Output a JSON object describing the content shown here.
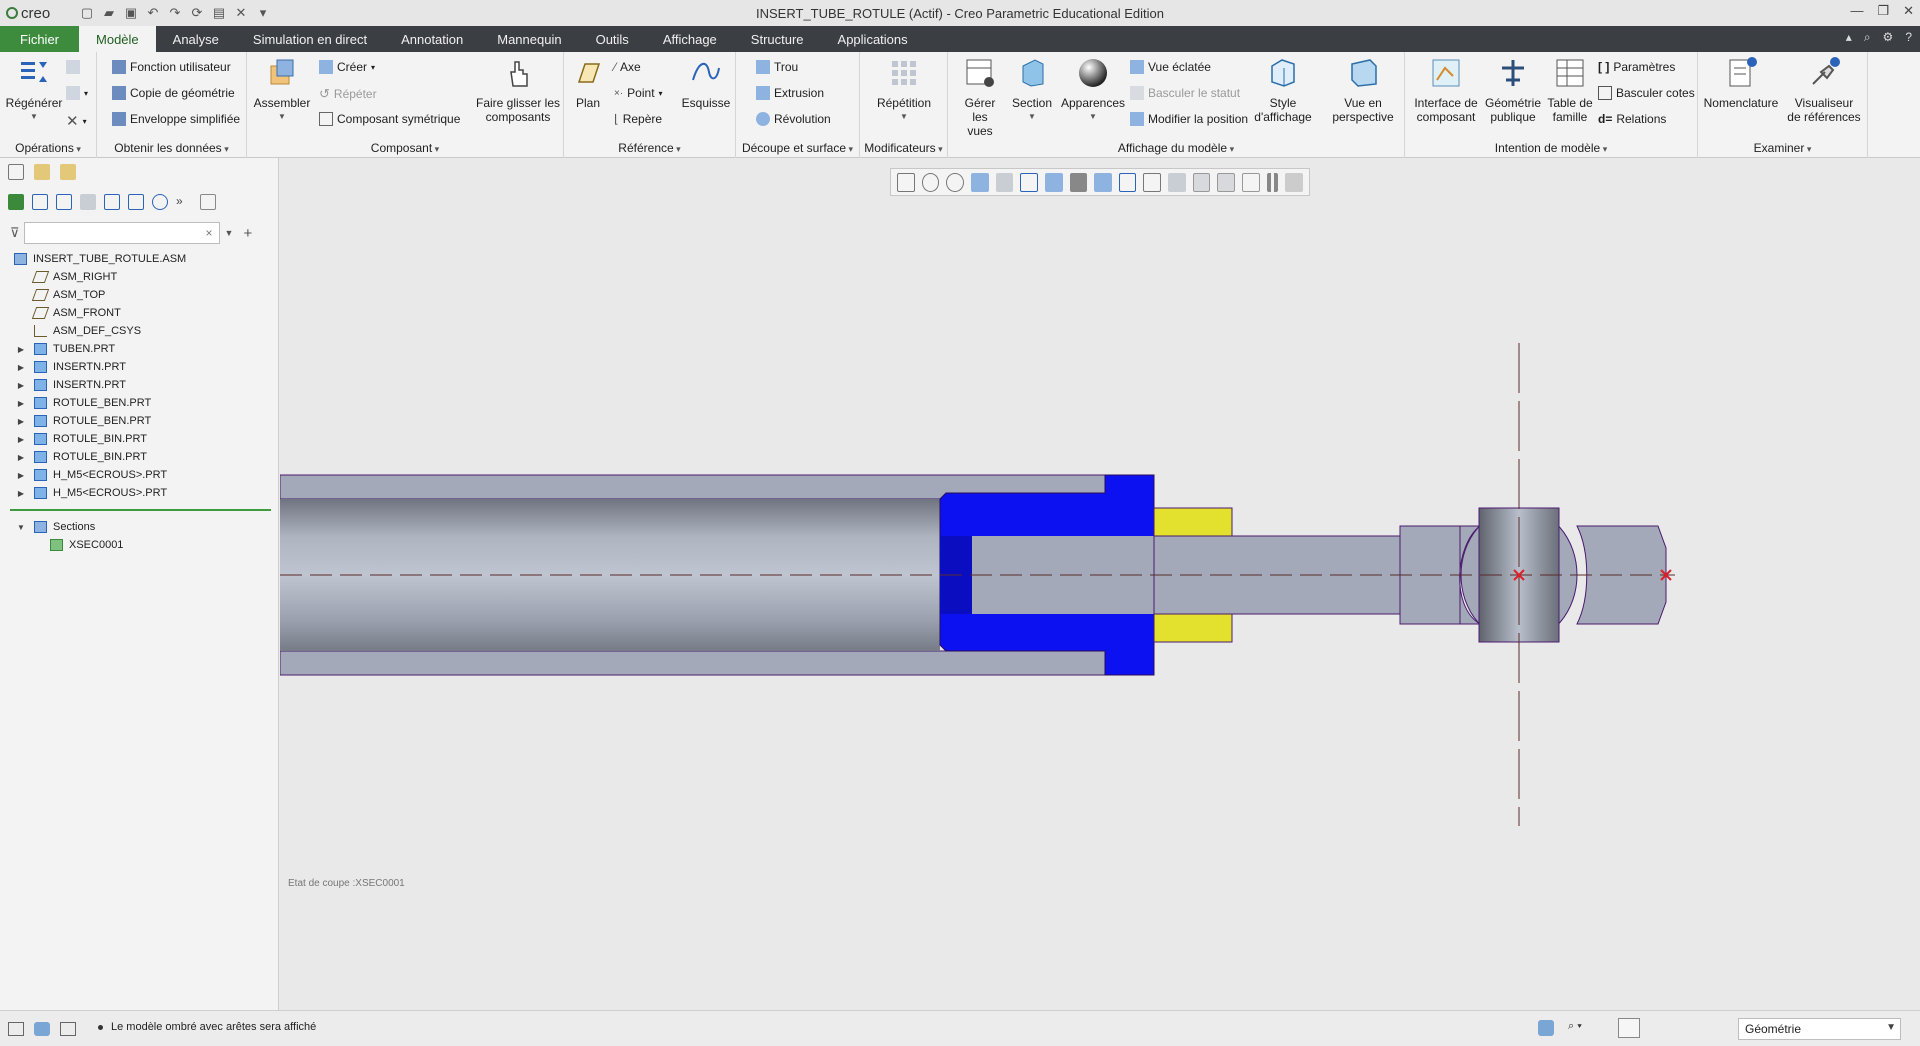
{
  "window": {
    "app_logo": "creo",
    "title": "INSERT_TUBE_ROTULE (Actif) - Creo Parametric Educational Edition",
    "quick_access_icons": [
      "new-icon",
      "open-icon",
      "save-icon",
      "undo-icon",
      "redo-icon",
      "regenerate-icon",
      "windows-icon",
      "close-window-icon",
      "customize-icon"
    ],
    "controls": [
      "minimize",
      "restore",
      "close"
    ]
  },
  "tabs": [
    {
      "label": "Fichier",
      "kind": "file"
    },
    {
      "label": "Modèle",
      "kind": "active"
    },
    {
      "label": "Analyse"
    },
    {
      "label": "Simulation en direct"
    },
    {
      "label": "Annotation"
    },
    {
      "label": "Mannequin"
    },
    {
      "label": "Outils"
    },
    {
      "label": "Affichage"
    },
    {
      "label": "Structure"
    },
    {
      "label": "Applications"
    }
  ],
  "ribbon": {
    "groups": {
      "operations": "Opérations",
      "obtenir": "Obtenir les données",
      "composant": "Composant",
      "reference": "Référence",
      "decoupe": "Découpe et surface",
      "modificateurs": "Modificateurs",
      "affichage": "Affichage du modèle",
      "intention": "Intention de modèle",
      "examiner": "Examiner"
    },
    "buttons": {
      "regenerer": "Régénérer",
      "fonction_utilisateur": "Fonction utilisateur",
      "copie_geometrie": "Copie de géométrie",
      "enveloppe": "Enveloppe simplifiée",
      "assembler": "Assembler",
      "creer": "Créer",
      "repeter": "Répéter",
      "composant_symetrique": "Composant symétrique",
      "faire_glisser_1": "Faire glisser les",
      "faire_glisser_2": "composants",
      "plan": "Plan",
      "axe": "Axe",
      "point": "Point",
      "repere": "Repère",
      "esquisse": "Esquisse",
      "trou": "Trou",
      "extrusion": "Extrusion",
      "revolution": "Révolution",
      "repetition": "Répétition",
      "gerer_vues_1": "Gérer les",
      "gerer_vues_2": "vues",
      "section": "Section",
      "apparences": "Apparences",
      "vue_eclatee": "Vue éclatée",
      "basculer_statut": "Basculer le statut",
      "modifier_position": "Modifier la position",
      "style_affichage_1": "Style",
      "style_affichage_2": "d'affichage",
      "vue_perspective_1": "Vue en",
      "vue_perspective_2": "perspective",
      "interface_1": "Interface de",
      "interface_2": "composant",
      "geometrie_publique_1": "Géométrie",
      "geometrie_publique_2": "publique",
      "table_famille_1": "Table de",
      "table_famille_2": "famille",
      "parametres": "Paramètres",
      "basculer_cotes": "Basculer cotes",
      "relations": "Relations",
      "nomenclature": "Nomenclature",
      "visualiseur_1": "Visualiseur",
      "visualiseur_2": "de références"
    }
  },
  "model_tree": {
    "filter_placeholder": "",
    "items": [
      {
        "label": "INSERT_TUBE_ROTULE.ASM",
        "icon": "assembly-icon",
        "indent": 0,
        "expander": ""
      },
      {
        "label": "ASM_RIGHT",
        "icon": "datum-plane-icon",
        "indent": 1,
        "expander": ""
      },
      {
        "label": "ASM_TOP",
        "icon": "datum-plane-icon",
        "indent": 1,
        "expander": ""
      },
      {
        "label": "ASM_FRONT",
        "icon": "datum-plane-icon",
        "indent": 1,
        "expander": ""
      },
      {
        "label": "ASM_DEF_CSYS",
        "icon": "csys-icon",
        "indent": 1,
        "expander": ""
      },
      {
        "label": "TUBEN.PRT",
        "icon": "part-icon",
        "indent": 1,
        "expander": "▶"
      },
      {
        "label": "INSERTN.PRT",
        "icon": "part-icon",
        "indent": 1,
        "expander": "▶"
      },
      {
        "label": "INSERTN.PRT",
        "icon": "part-icon",
        "indent": 1,
        "expander": "▶"
      },
      {
        "label": "ROTULE_BEN.PRT",
        "icon": "part-icon",
        "indent": 1,
        "expander": "▶"
      },
      {
        "label": "ROTULE_BEN.PRT",
        "icon": "part-icon",
        "indent": 1,
        "expander": "▶"
      },
      {
        "label": "ROTULE_BIN.PRT",
        "icon": "part-icon",
        "indent": 1,
        "expander": "▶"
      },
      {
        "label": "ROTULE_BIN.PRT",
        "icon": "part-icon",
        "indent": 1,
        "expander": "▶"
      },
      {
        "label": "H_M5<ECROUS>.PRT",
        "icon": "part-icon",
        "indent": 1,
        "expander": "▶"
      },
      {
        "label": "H_M5<ECROUS>.PRT",
        "icon": "part-icon",
        "indent": 1,
        "expander": "▶"
      }
    ],
    "sections": {
      "label": "Sections",
      "child": "XSEC0001"
    }
  },
  "viewport": {
    "section_state": "Etat de coupe :XSEC0001"
  },
  "statusbar": {
    "message": "Le modèle ombré avec arêtes sera affiché",
    "selection_filter": "Géométrie"
  },
  "colors": {
    "file_tab": "#3d8b3d",
    "tab_bar": "#3b3e42",
    "part_gray": "#a3a9b8",
    "insert_blue": "#0b11f0",
    "nut_yellow": "#e3e02e",
    "edge_purple": "#4a1a6e"
  }
}
